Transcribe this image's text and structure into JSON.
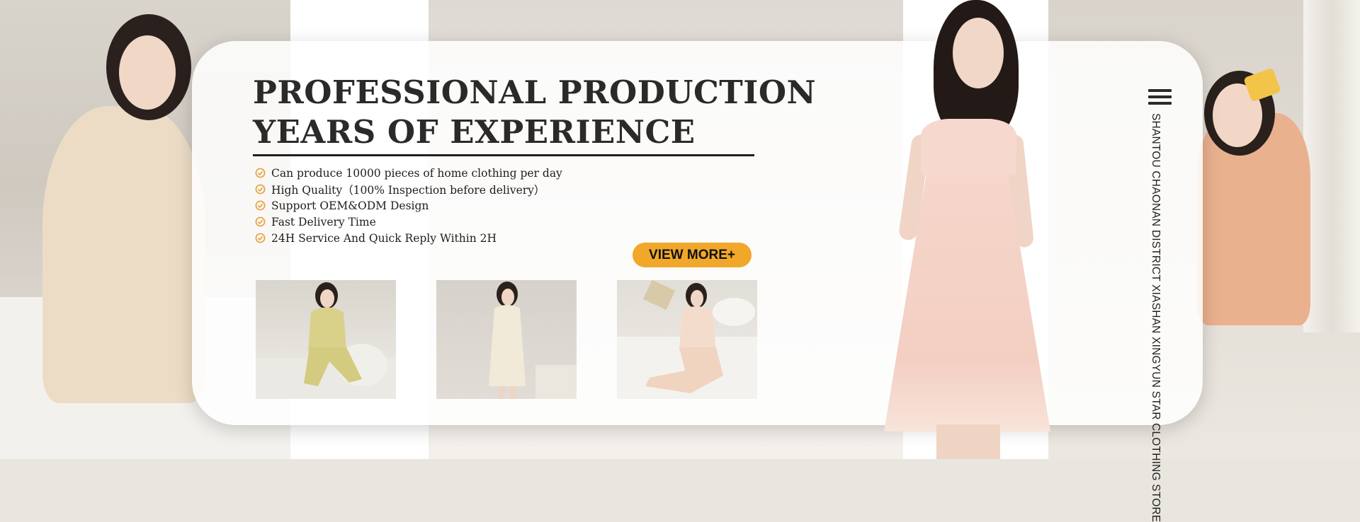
{
  "banner": {
    "title_line1": "PROFESSIONAL PRODUCTION",
    "title_line2": "YEARS OF EXPERIENCE",
    "features": [
      "Can produce 10000 pieces of home clothing per day",
      "High Quality（100% Inspection before delivery）",
      "Support OEM&ODM Design",
      "Fast Delivery Time",
      "24H Service And Quick Reply Within 2H"
    ],
    "cta_label": "VIEW MORE+",
    "store_name": "SHANTOU CHAONAN DISTRICT XIASHAN XINGYUN STAR CLOTHING STORE"
  },
  "thumbnails": [
    {
      "icon": "model-yellow-pajamas-photo"
    },
    {
      "icon": "model-cream-nightdress-photo"
    },
    {
      "icon": "model-peach-pajamas-photo"
    }
  ],
  "colors": {
    "accent": "#f1a72a",
    "check": "#e8a23a",
    "title": "#2b2a29",
    "card": "#ffffff"
  },
  "icons": {
    "menu": "menu-icon",
    "check": "check-circle-icon"
  }
}
